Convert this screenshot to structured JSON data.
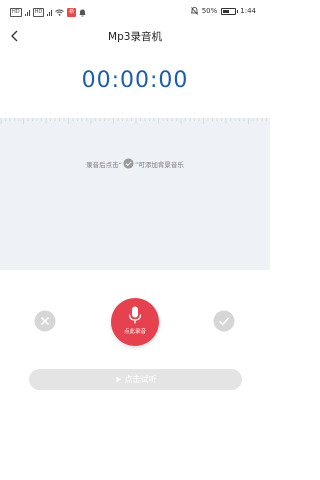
{
  "status_bar": {
    "left_badges": [
      "HD",
      "HD",
      "5G"
    ],
    "signal": "4G",
    "notification": "新",
    "battery": "50%",
    "battery_level": 0.5,
    "time": "1:44"
  },
  "header": {
    "title": "Mp3录音机"
  },
  "timer": "00:00:00",
  "hint": {
    "before": "录音后点击“",
    "after": "”可添加背景音乐"
  },
  "controls": {
    "record_label": "点此录音"
  },
  "preview": {
    "label": "点击试听"
  },
  "colors": {
    "accent_blue": "#1b5fa8",
    "record_red": "#e5414e",
    "wave_bg": "#eef2f7",
    "disabled_gray": "#d0d0d0"
  },
  "icons": {
    "back": "back-arrow-icon",
    "cancel": "close-circle-icon",
    "confirm": "check-circle-icon",
    "record": "microphone-icon",
    "preview": "play-icon"
  }
}
